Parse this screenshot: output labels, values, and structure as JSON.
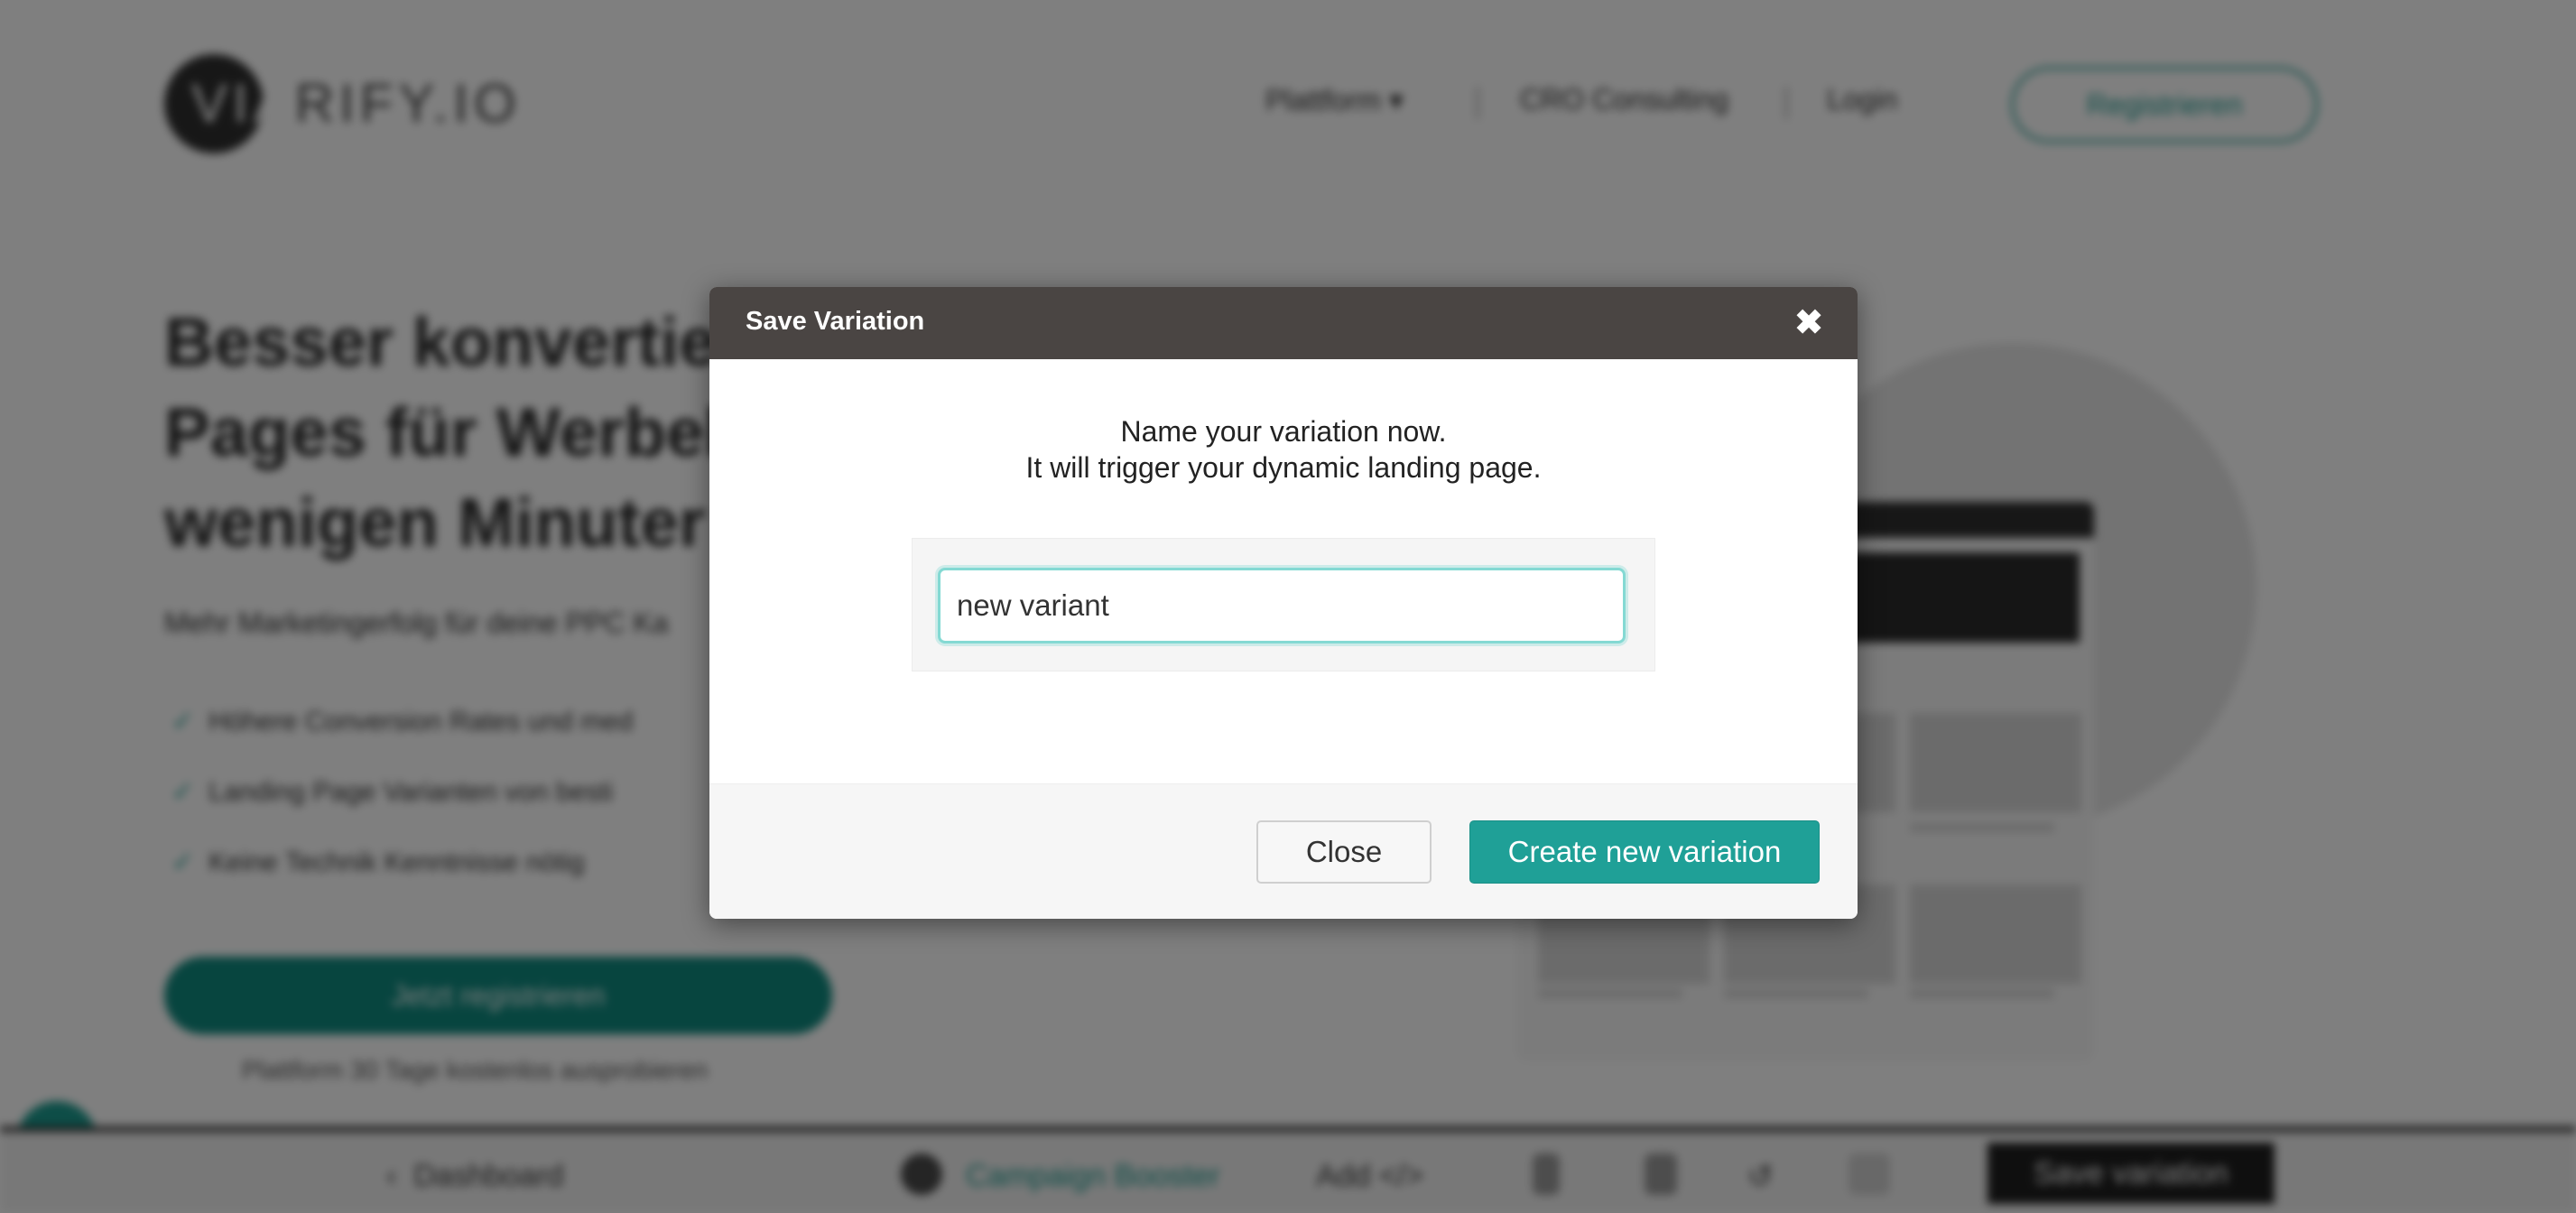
{
  "background": {
    "logo": {
      "mark": "VIA",
      "rest": "RIFY.IO",
      "icon": "logo-icon"
    },
    "nav": {
      "items": [
        "Plattform",
        "CRO Consulting",
        "Login"
      ],
      "dropdown_icon": "chevron-down-icon",
      "cta_label": "Registrieren"
    },
    "hero": {
      "title_lines": [
        "Besser konvertier",
        "Pages für Werbel",
        "wenigen Minuter"
      ],
      "subtitle": "Mehr Marketingerfolg für deine PPC Ka",
      "checks": [
        "Höhere Conversion Rates und med",
        "Landing Page Varianten von besti",
        "Keine Technik Kenntnisse nötig"
      ],
      "cta_label": "Jetzt registrieren",
      "cta_note": "Plattform 30 Tage kostenlos ausprobieren"
    },
    "toolbar": {
      "dashboard_label": "Dashboard",
      "campaign_label": "Campaign Booster",
      "add_label": "Add",
      "save_label": "Save variation"
    }
  },
  "modal": {
    "title": "Save Variation",
    "close_icon": "close-icon",
    "intro_line1": "Name your variation now.",
    "intro_line2": "It will trigger your dynamic landing page.",
    "input_value": "new variant",
    "close_label": "Close",
    "create_label": "Create new variation"
  },
  "colors": {
    "accent": "#1fa097",
    "modal_header": "#4a4543",
    "input_focus": "#84d9d3",
    "overlay": "rgba(0,0,0,0.5)"
  }
}
